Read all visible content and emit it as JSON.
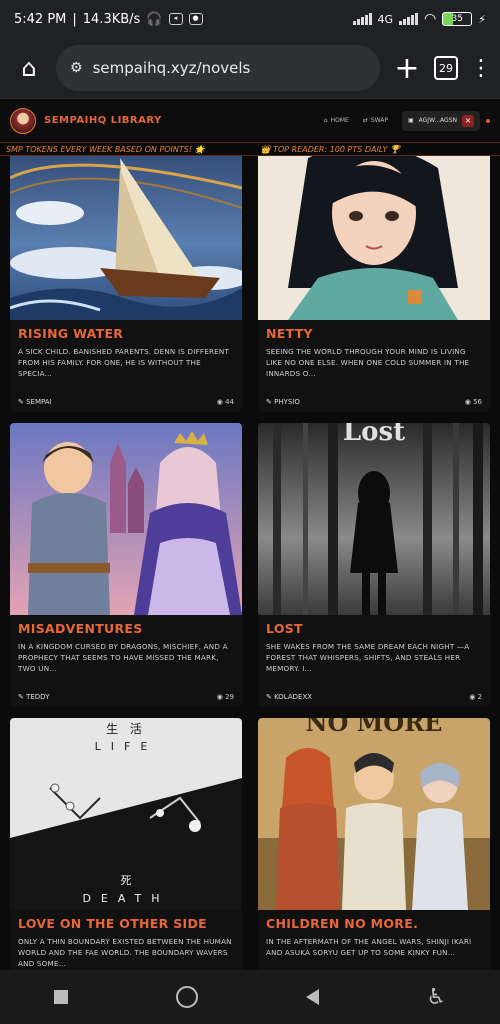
{
  "status": {
    "time": "5:42 PM",
    "speed": "14.3KB/s",
    "network": "4G",
    "battery": "35"
  },
  "browser": {
    "url": "sempaihq.xyz/novels",
    "tab_count": "29"
  },
  "site": {
    "title": "SEMPAIHQ LIBRARY",
    "nav_home": "HOME",
    "nav_swap": "SWAP",
    "user_label": "AGJW...AGSN",
    "close_label": "×"
  },
  "ticker": {
    "msg1": "SMP TOKENS EVERY WEEK BASED ON POINTS! 🌟",
    "msg2": "👑 TOP READER: 100 PTS DAILY 🏆"
  },
  "cards": [
    {
      "title": "RISING WATER",
      "desc": "A SICK CHILD. BANISHED PARENTS. DENN IS DIFFERENT FROM HIS FAMILY. FOR ONE, HE IS WITHOUT THE SPECIA...",
      "author": "SEMPAI",
      "views": "44"
    },
    {
      "title": "NETTY",
      "desc": "SEEING THE WORLD THROUGH YOUR MIND IS LIVING LIKE NO ONE ELSE. WHEN ONE COLD SUMMER IN THE INNARDS O...",
      "author": "PHYSIO",
      "views": "56"
    },
    {
      "title": "MISADVENTURES",
      "desc": "IN A KINGDOM CURSED BY DRAGONS, MISCHIEF, AND A PROPHECY THAT SEEMS TO HAVE MISSED THE MARK, TWO UN...",
      "author": "TEDDY",
      "views": "29"
    },
    {
      "title": "LOST",
      "desc": "SHE WAKES FROM THE SAME DREAM EACH NIGHT —A FOREST THAT WHISPERS, SHIFTS, AND STEALS HER MEMORY. I...",
      "author": "KOLADEXX",
      "views": "2"
    },
    {
      "title": "LOVE ON THE OTHER SIDE",
      "desc": "ONLY A THIN BOUNDARY EXISTED BETWEEN THE HUMAN WORLD AND THE FAE WORLD. THE BOUNDARY WAVERS AND SOME...",
      "author": "",
      "views": ""
    },
    {
      "title": "CHILDREN NO MORE.",
      "desc": "IN THE AFTERMATH OF THE ANGEL WARS, SHINJI IKARI AND ASUKA SORYU GET UP TO SOME KINKY FUN...",
      "author": "",
      "views": ""
    }
  ],
  "covers": {
    "lost_text": "Lost",
    "life_kanji": "生 活",
    "life_word": "LIFE",
    "death_kanji": "死",
    "death_word": "DEATH",
    "nomore_text": "NO MORE"
  }
}
